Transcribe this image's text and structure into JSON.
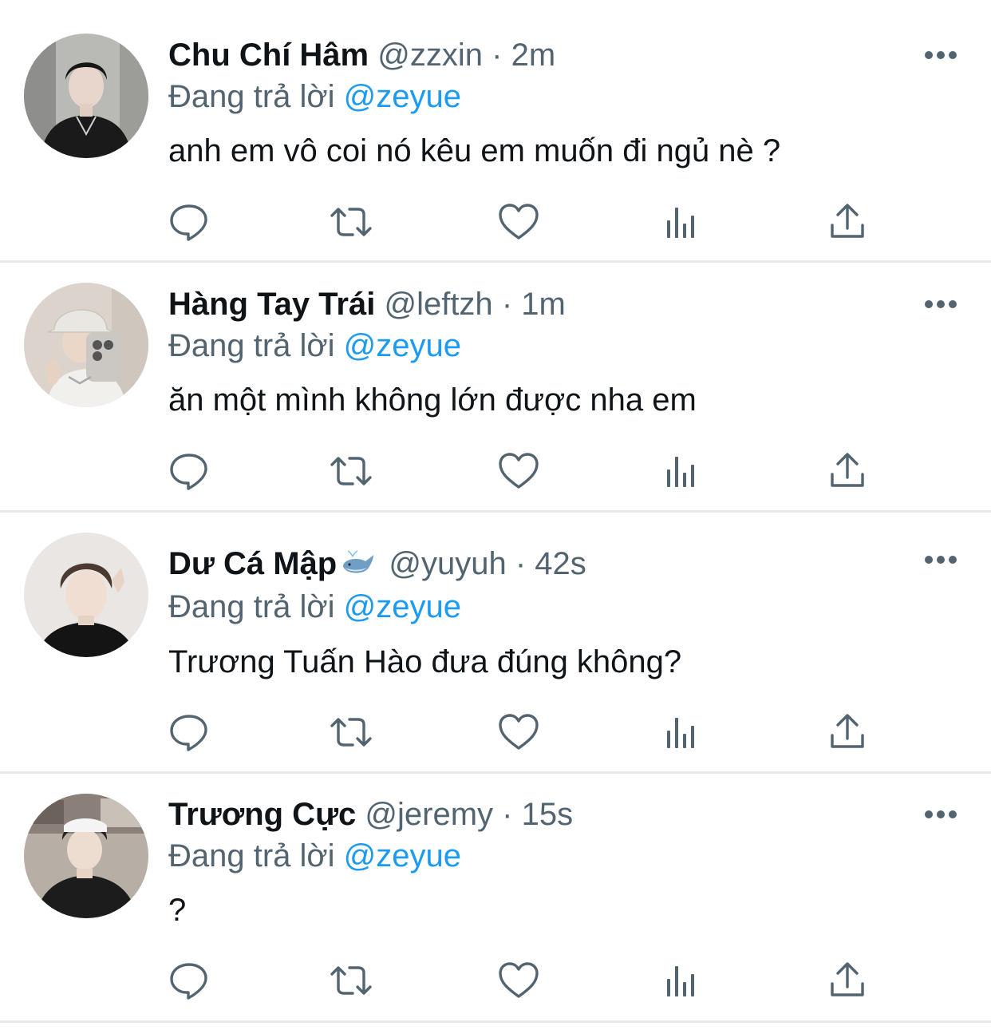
{
  "colors": {
    "text": "#0f1419",
    "secondary": "#536471",
    "mention": "#1d9bf0",
    "divider": "#e7e9eb"
  },
  "tweets": [
    {
      "name": "Chu Chí Hâm",
      "handle": "@zzxin",
      "dot": "·",
      "time": "2m",
      "reply_prefix": "Đang trả lời",
      "reply_to": "@zeyue",
      "text": "anh em vô coi nó kêu em muốn đi ngủ nè ?"
    },
    {
      "name": "Hàng Tay Trái",
      "handle": "@leftzh",
      "dot": "·",
      "time": "1m",
      "reply_prefix": "Đang trả lời",
      "reply_to": "@zeyue",
      "text": "ăn một mình không lớn được nha em"
    },
    {
      "name": "Dư Cá Mập",
      "name_emoji": "whale-icon",
      "handle": "@yuyuh",
      "dot": "·",
      "time": "42s",
      "reply_prefix": "Đang trả lời",
      "reply_to": "@zeyue",
      "text": "Trương Tuấn Hào đưa đúng không?"
    },
    {
      "name": "Trương Cực",
      "handle": "@jeremy",
      "dot": "·",
      "time": "15s",
      "reply_prefix": "Đang trả lời",
      "reply_to": "@zeyue",
      "text": "?"
    }
  ],
  "action_icons": [
    "reply-icon",
    "retweet-icon",
    "like-icon",
    "views-icon",
    "share-icon"
  ]
}
